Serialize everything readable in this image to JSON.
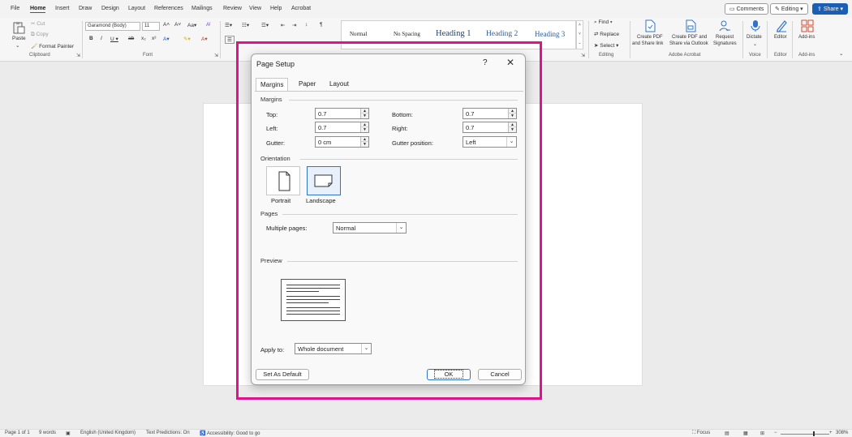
{
  "menu": {
    "items": [
      "File",
      "Home",
      "Insert",
      "Draw",
      "Design",
      "Layout",
      "References",
      "Mailings",
      "Review",
      "View",
      "Help",
      "Acrobat"
    ],
    "active": "Home",
    "comments": "Comments",
    "editing": "Editing",
    "share": "Share"
  },
  "ribbon": {
    "clipboard": {
      "paste": "Paste",
      "cut": "Cut",
      "copy": "Copy",
      "format_painter": "Format Painter",
      "label": "Clipboard"
    },
    "font": {
      "name": "Garamond (Body)",
      "size": "11",
      "label": "Font"
    },
    "styles": {
      "items": [
        "Normal",
        "No Spacing",
        "Heading 1",
        "Heading 2",
        "Heading 3"
      ]
    },
    "editing": {
      "find": "Find",
      "replace": "Replace",
      "select": "Select",
      "label": "Editing"
    },
    "acrobat": {
      "create_pdf": "Create PDF",
      "share_link": "and Share link",
      "create_pdf_outlook": "Create PDF and",
      "share_outlook": "Share via Outlook",
      "request": "Request",
      "signatures": "Signatures",
      "label": "Adobe Acrobat"
    },
    "voice": {
      "dictate": "Dictate",
      "label": "Voice"
    },
    "editor": {
      "editor": "Editor",
      "label": "Editor"
    },
    "addins": {
      "addins": "Add-ins",
      "label": "Add-ins"
    }
  },
  "dialog": {
    "title": "Page Setup",
    "help": "?",
    "close": "✕",
    "tabs": [
      "Margins",
      "Paper",
      "Layout"
    ],
    "active_tab": "Margins",
    "margins": {
      "section": "Margins",
      "top_label": "Top:",
      "top": "0.7",
      "bottom_label": "Bottom:",
      "bottom": "0.7",
      "left_label": "Left:",
      "left": "0.7",
      "right_label": "Right:",
      "right": "0.7",
      "gutter_label": "Gutter:",
      "gutter": "0 cm",
      "gutter_position_label": "Gutter position:",
      "gutter_position": "Left"
    },
    "orientation": {
      "section": "Orientation",
      "portrait": "Portrait",
      "landscape": "Landscape",
      "selected": "Landscape"
    },
    "pages": {
      "section": "Pages",
      "multiple_pages_label": "Multiple pages:",
      "multiple_pages": "Normal"
    },
    "preview": {
      "section": "Preview"
    },
    "apply_to_label": "Apply to:",
    "apply_to": "Whole document",
    "set_default": "Set As Default",
    "ok": "OK",
    "cancel": "Cancel"
  },
  "status": {
    "page": "Page 1 of 1",
    "words": "9 words",
    "language": "English (United Kingdom)",
    "text_predictions": "Text Predictions: On",
    "accessibility": "Accessibility: Good to go",
    "focus": "Focus",
    "zoom": "308%"
  },
  "colors": {
    "highlight": "#e0138c",
    "accent": "#1a5fb4",
    "selected": "#2f74c8"
  }
}
